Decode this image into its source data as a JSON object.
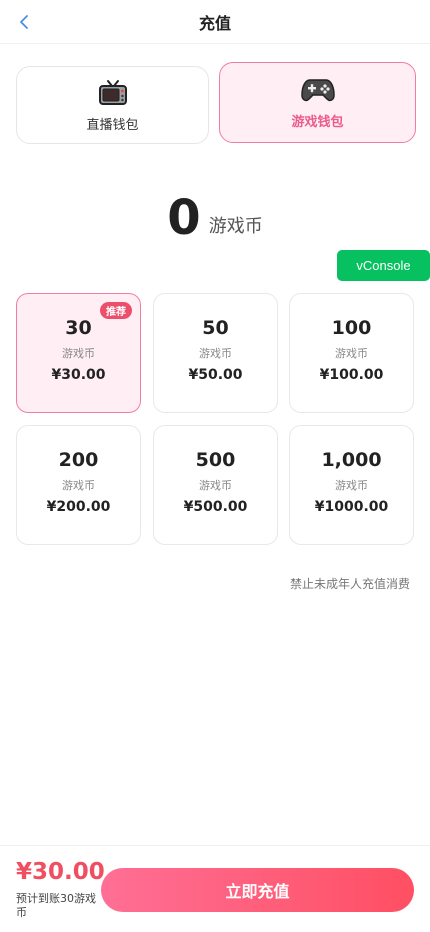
{
  "header": {
    "title": "充值",
    "back_icon": "chevron-left-icon"
  },
  "wallets": [
    {
      "label": "直播钱包",
      "icon": "tv-icon",
      "selected": false
    },
    {
      "label": "游戏钱包",
      "icon": "gamepad-icon",
      "selected": true
    }
  ],
  "balance": {
    "value": "0",
    "unit": "游戏币"
  },
  "vconsole": {
    "label": "vConsole"
  },
  "packages": [
    {
      "coins": "30",
      "unit": "游戏币",
      "price": "¥30.00",
      "selected": true,
      "badge": "推荐"
    },
    {
      "coins": "50",
      "unit": "游戏币",
      "price": "¥50.00",
      "selected": false
    },
    {
      "coins": "100",
      "unit": "游戏币",
      "price": "¥100.00",
      "selected": false
    },
    {
      "coins": "200",
      "unit": "游戏币",
      "price": "¥200.00",
      "selected": false
    },
    {
      "coins": "500",
      "unit": "游戏币",
      "price": "¥500.00",
      "selected": false
    },
    {
      "coins": "1,000",
      "unit": "游戏币",
      "price": "¥1000.00",
      "selected": false
    }
  ],
  "notice": "禁止未成年人充值消费",
  "footer": {
    "total": "¥30.00",
    "estimate": "预计到账30游戏币",
    "pay_label": "立即充值"
  },
  "colors": {
    "accent_pink": "#ea5c8b",
    "selected_bg": "#ffeef3",
    "badge_red": "#ec4f6c",
    "price_red": "#ef4f60",
    "vconsole_green": "#07c160"
  }
}
